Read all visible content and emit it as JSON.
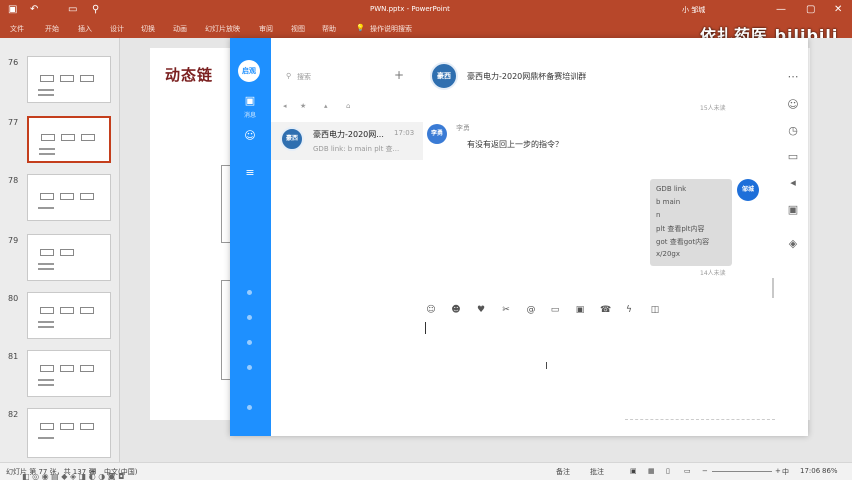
{
  "app": {
    "window_title": "PWN.pptx - PowerPoint",
    "user_name": "小 邹城",
    "ribbon_tabs": [
      "文件",
      "开始",
      "插入",
      "设计",
      "切换",
      "动画",
      "幻灯片放映",
      "审阅",
      "视图",
      "帮助"
    ],
    "tell_me": "操作说明搜索"
  },
  "watermark": {
    "text": "依扎药医 bilibili"
  },
  "thumbnails": [
    {
      "num": "76",
      "active": false
    },
    {
      "num": "77",
      "active": true
    },
    {
      "num": "78",
      "active": false
    },
    {
      "num": "79",
      "active": false
    },
    {
      "num": "80",
      "active": false
    },
    {
      "num": "81",
      "active": false
    },
    {
      "num": "82",
      "active": false
    }
  ],
  "slide": {
    "title_visible": "动态链"
  },
  "statusbar": {
    "slide_info": "幻灯片 第 77 张，共 137 张",
    "language": "中文(中国)",
    "notes": "备注",
    "comments": "批注",
    "zoom": "86%",
    "clock": "17:06",
    "ime": "中"
  },
  "chat": {
    "nav": {
      "top_avatar": "启观",
      "items": [
        {
          "icon": "message-icon",
          "label": "消息"
        },
        {
          "icon": "contacts-icon",
          "label": ""
        },
        {
          "icon": "collection-icon",
          "label": ""
        }
      ]
    },
    "search_placeholder": "搜索",
    "add_symbol": "+",
    "conversation": {
      "name": "豪西电力-2020网...",
      "time": "17:03",
      "preview": "GDB link: b main plt 查..."
    },
    "header": {
      "group_name": "豪西电力-2020网鼎杯备赛培训群",
      "group_avatar_text": "豪西",
      "top_status": "15人未读"
    },
    "messages": [
      {
        "sender": "李勇",
        "avatar_text": "李勇",
        "text": "有没有返回上一步的指令？"
      }
    ],
    "my_message": {
      "avatar_text": "邹城",
      "lines": [
        "GDB link",
        "b main",
        "n",
        "plt 查看plt内容",
        "got 查看got内容",
        "x/20gx"
      ],
      "read_status": "14人未读"
    },
    "toolbar_icons": [
      "emoji-icon",
      "face-icon",
      "like-icon",
      "scissors-icon",
      "at-icon",
      "folder-icon",
      "image-icon",
      "phone-icon",
      "lightning-icon",
      "screenshot-icon"
    ]
  }
}
